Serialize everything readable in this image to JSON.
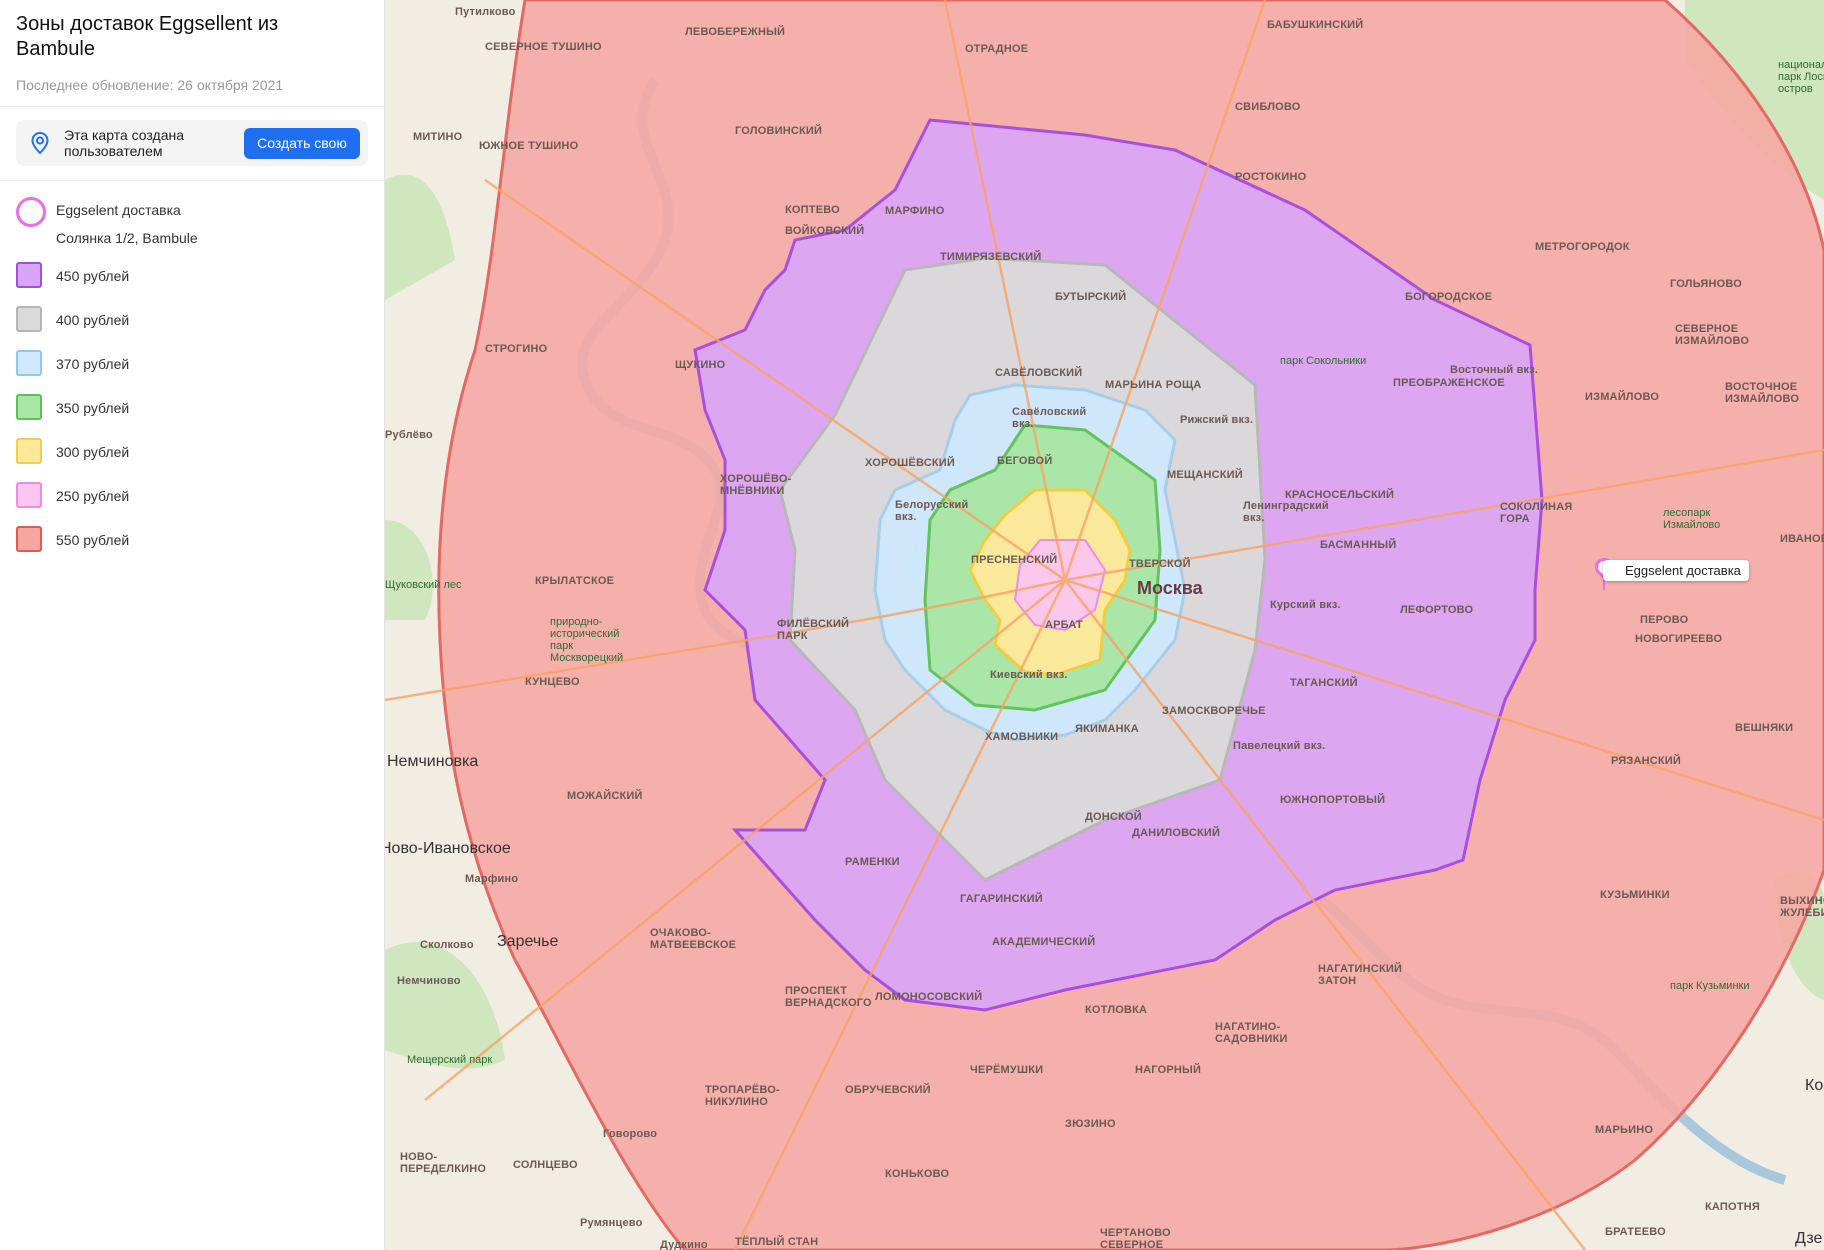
{
  "sidebar": {
    "title": "Зоны доставок Eggsellent из Bambule",
    "updated": "Последнее обновление: 26 октября 2021",
    "info_text": "Эта карта создана пользователем",
    "create_button": "Создать свою",
    "point": {
      "title": "Eggselent доставка",
      "address": "Солянка 1/2, Bambule",
      "color": "#e96ee3"
    },
    "legend": [
      {
        "label": "450 рублей",
        "fill": "#d9a6f7",
        "border": "#a24fe0"
      },
      {
        "label": "400 рублей",
        "fill": "#dadada",
        "border": "#b5b5b5"
      },
      {
        "label": "370 рублей",
        "fill": "#cfe8fb",
        "border": "#8cc8f0"
      },
      {
        "label": "350 рублей",
        "fill": "#a8e6a3",
        "border": "#5bc259"
      },
      {
        "label": "300 рублей",
        "fill": "#fde89b",
        "border": "#f1cf4c"
      },
      {
        "label": "250 рублей",
        "fill": "#fbc6f0",
        "border": "#ef8ce1"
      },
      {
        "label": "550 рублей",
        "fill": "#f6a7a3",
        "border": "#e05a55"
      }
    ]
  },
  "map": {
    "marker_label": "Eggselent доставка",
    "city_label": "Москва",
    "place_labels": [
      "Путилково",
      "СЕВЕРНОЕ ТУШИНО",
      "ЛЕВОБЕРЕЖНЫЙ",
      "ОТРАДНОЕ",
      "БАБУШКИНСКИЙ",
      "МИТИНО",
      "ЮЖНОЕ ТУШИНО",
      "ГОЛОВИНСКИЙ",
      "СВИБЛОВО",
      "КОПТЕВО",
      "ВОЙКОВСКИЙ",
      "МАРФИНО",
      "РОСТОКИНО",
      "ТИМИРЯЗЕВСКИЙ",
      "МЕТРОГОРОДОК",
      "БУТЫРСКИЙ",
      "БОГОРОДСКОЕ",
      "ГОЛЬЯНОВО",
      "СТРОГИНО",
      "ЩУКИНО",
      "САВЁЛОВСКИЙ",
      "МАРЬИНА РОЩА",
      "СЕВЕРНОЕ ИЗМАЙЛОВО",
      "ПРЕОБРАЖЕНСКОЕ",
      "ИЗМАЙЛОВО",
      "ВОСТОЧНОЕ ИЗМАЙЛОВО",
      "Рублёво",
      "ХОРОШЁВСКИЙ",
      "БЕГОВОЙ",
      "МЕЩАНСКИЙ",
      "ХОРОШЁВО-МНЁВНИКИ",
      "КРАСНОСЕЛЬСКИЙ",
      "СОКОЛИНАЯ ГОРА",
      "ИВАНОВСКОЕ",
      "ПРЕСНЕНСКИЙ",
      "ТВЕРСКОЙ",
      "БАСМАННЫЙ",
      "КРЫЛАТСКОЕ",
      "ЛЕФОРТОВО",
      "ПЕРОВО",
      "ФИЛЁВСКИЙ ПАРК",
      "АРБАТ",
      "НОВОГИРЕЕВО",
      "КУНЦЕВО",
      "ТАГАНСКИЙ",
      "ХАМОВНИКИ",
      "ЗАМОСКВОРЕЧЬЕ",
      "ВЕШНЯКИ",
      "Немчиновка",
      "ЯКИМАНКА",
      "РЯЗАНСКИЙ",
      "МОЖАЙСКИЙ",
      "ДОНСКОЙ",
      "ЮЖНОПОРТОВЫЙ",
      "Ново-Ивановское",
      "ДАНИЛОВСКИЙ",
      "РАМЕНКИ",
      "Марфино",
      "ГАГАРИНСКИЙ",
      "КУЗЬМИНКИ",
      "Сколково",
      "Заречье",
      "ОЧАКОВО-МАТВЕЕВСКОЕ",
      "АКАДЕМИЧЕСКИЙ",
      "ВЫХИНО-ЖУЛЕБИНО",
      "Немчиново",
      "НАГАТИНСКИЙ ЗАТОН",
      "ПРОСПЕКТ ВЕРНАДСКОГО",
      "ЛОМОНОСОВСКИЙ",
      "КОТЛОВКА",
      "НАГАТИНО-САДОВНИКИ",
      "МАРЬИНО",
      "ЧЕРЁМУШКИ",
      "НАГОРНЫЙ",
      "ТРОПАРЁВО-НИКУЛИНО",
      "ОБРУЧЕВСКИЙ",
      "ЗЮЗИНО",
      "Говорово",
      "СОЛНЦЕВО",
      "НОВО-ПЕРЕДЕЛКИНО",
      "КОНЬКОВО",
      "Румянцево",
      "ТЁПЛЫЙ СТАН",
      "ЧЕРТАНОВО СЕВЕРНОЕ",
      "КАПОТНЯ",
      "БРАТЕЕВО",
      "Дзе",
      "Ко",
      "Дудкино"
    ],
    "park_labels": [
      "национальный парк Лосиный остров",
      "парк Сокольники",
      "лесопарк Измайлово",
      "природно-исторический парк Москворецкий",
      "Мещерский парк",
      "парк Кузьминки",
      "Щуковский лес"
    ],
    "station_labels": [
      "Рижский вкз.",
      "Савёловский вкз.",
      "Ленинградский вкз.",
      "Белорусский вкз.",
      "Курский вкз.",
      "Восточный вкз.",
      "Киевский вкз.",
      "Павелецкий вкз."
    ]
  }
}
